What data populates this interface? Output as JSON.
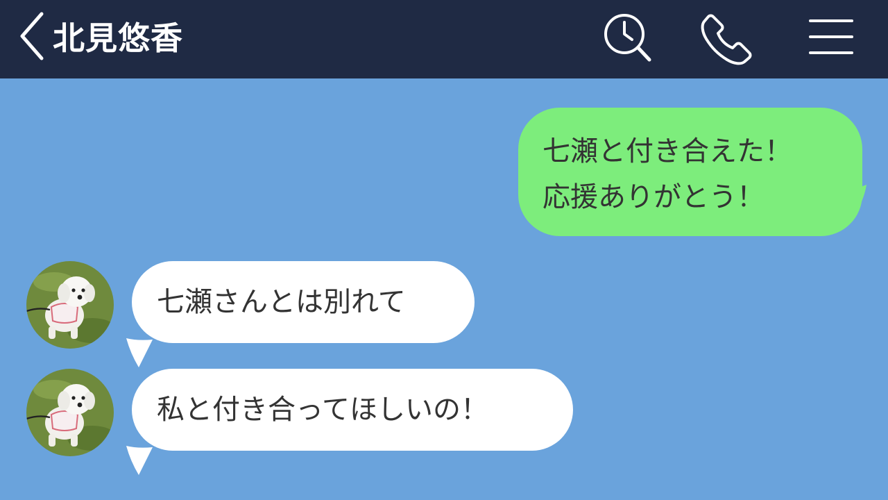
{
  "header": {
    "title": "北見悠香",
    "icons": [
      "back-chevron-icon",
      "search-clock-icon",
      "phone-icon",
      "menu-icon"
    ],
    "background_color": "#1f2a44"
  },
  "chat": {
    "background_color": "#6aa3dc",
    "outgoing_bubble_color": "#7ded7c",
    "incoming_bubble_color": "#ffffff",
    "messages": [
      {
        "direction": "outgoing",
        "lines": [
          "七瀬と付き合えた！",
          "応援ありがとう！"
        ]
      },
      {
        "direction": "incoming",
        "avatar": "dog-avatar",
        "text": "七瀬さんとは別れて"
      },
      {
        "direction": "incoming",
        "avatar": "dog-avatar",
        "text": "私と付き合ってほしいの！"
      }
    ]
  }
}
